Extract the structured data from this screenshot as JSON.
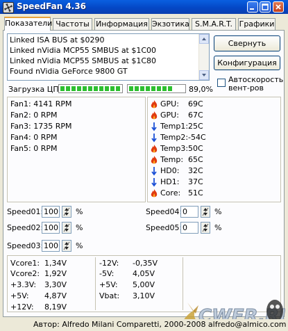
{
  "window": {
    "title": "SpeedFan 4.36"
  },
  "tabs": [
    {
      "label": "Показатели",
      "active": true
    },
    {
      "label": "Частоты"
    },
    {
      "label": "Информация"
    },
    {
      "label": "Экзотика"
    },
    {
      "label": "S.M.A.R.T."
    },
    {
      "label": "Графики"
    }
  ],
  "log": [
    "Linked ISA BUS at $0290",
    "Linked nVidia MCP55 SMBUS at $1C00",
    "Linked nVidia MCP55 SMBUS at $1C80",
    "Found nVidia GeForce 9800 GT"
  ],
  "buttons": {
    "collapse": "Свернуть",
    "config": "Конфигурация"
  },
  "autospeed": {
    "label_line1": "Автоскорость",
    "label_line2": "вент-ров",
    "checked": false
  },
  "cpu": {
    "label": "Загрузка ЦП",
    "core1_usage": 1.0,
    "core2_usage": 0.8,
    "percent": "89,0%"
  },
  "fans": [
    "Fan1: 4141 RPM",
    "Fan2: 0 RPM",
    "Fan3: 1735 RPM",
    "Fan4: 0 RPM",
    "Fan5: 0 RPM"
  ],
  "temps": [
    {
      "name": "GPU:",
      "value": "69C",
      "icon": "flame-icon"
    },
    {
      "name": "GPU:",
      "value": "67C",
      "icon": "flame-icon"
    },
    {
      "name": "Temp1:",
      "value": "25C",
      "icon": "arrow-down-icon"
    },
    {
      "name": "Temp2:",
      "value": "-54C",
      "icon": "arrow-down-icon"
    },
    {
      "name": "Temp3:",
      "value": "50C",
      "icon": "flame-icon"
    },
    {
      "name": "Temp:",
      "value": "65C",
      "icon": "flame-icon"
    },
    {
      "name": "HD0:",
      "value": "32C",
      "icon": "arrow-down-icon"
    },
    {
      "name": "HD1:",
      "value": "37C",
      "icon": "arrow-down-icon"
    },
    {
      "name": "Core:",
      "value": "51C",
      "icon": "flame-icon"
    }
  ],
  "speeds": [
    {
      "label": "Speed01:",
      "value": "100",
      "unit": "%"
    },
    {
      "label": "Speed02:",
      "value": "100",
      "unit": "%"
    },
    {
      "label": "Speed03:",
      "value": "100",
      "unit": "%"
    },
    {
      "label": "Speed04:",
      "value": "0",
      "unit": "%"
    },
    {
      "label": "Speed05:",
      "value": "0",
      "unit": "%"
    }
  ],
  "voltages_left": [
    {
      "name": "Vcore1:",
      "value": "1,34V"
    },
    {
      "name": "Vcore2:",
      "value": "1,92V"
    },
    {
      "name": "+3.3V:",
      "value": "3,30V"
    },
    {
      "name": "+5V:",
      "value": "4,87V"
    },
    {
      "name": "+12V:",
      "value": "8,19V"
    }
  ],
  "voltages_right": [
    {
      "name": "-12V:",
      "value": "-0,35V"
    },
    {
      "name": "-5V:",
      "value": "4,05V"
    },
    {
      "name": "+5V:",
      "value": "5,00V"
    },
    {
      "name": "Vbat:",
      "value": "3,10V"
    }
  ],
  "watermark": {
    "text": "CWER.RU"
  },
  "status": {
    "text": "Автор: Alfredo Milani Comparetti, 2000-2008  alfredo@almico.com"
  },
  "colors": {
    "flame": "#e03a10",
    "arrow_down": "#1a4fd6",
    "meter_fill": "#2ebf30",
    "tab_accent": "#e8a23a"
  }
}
